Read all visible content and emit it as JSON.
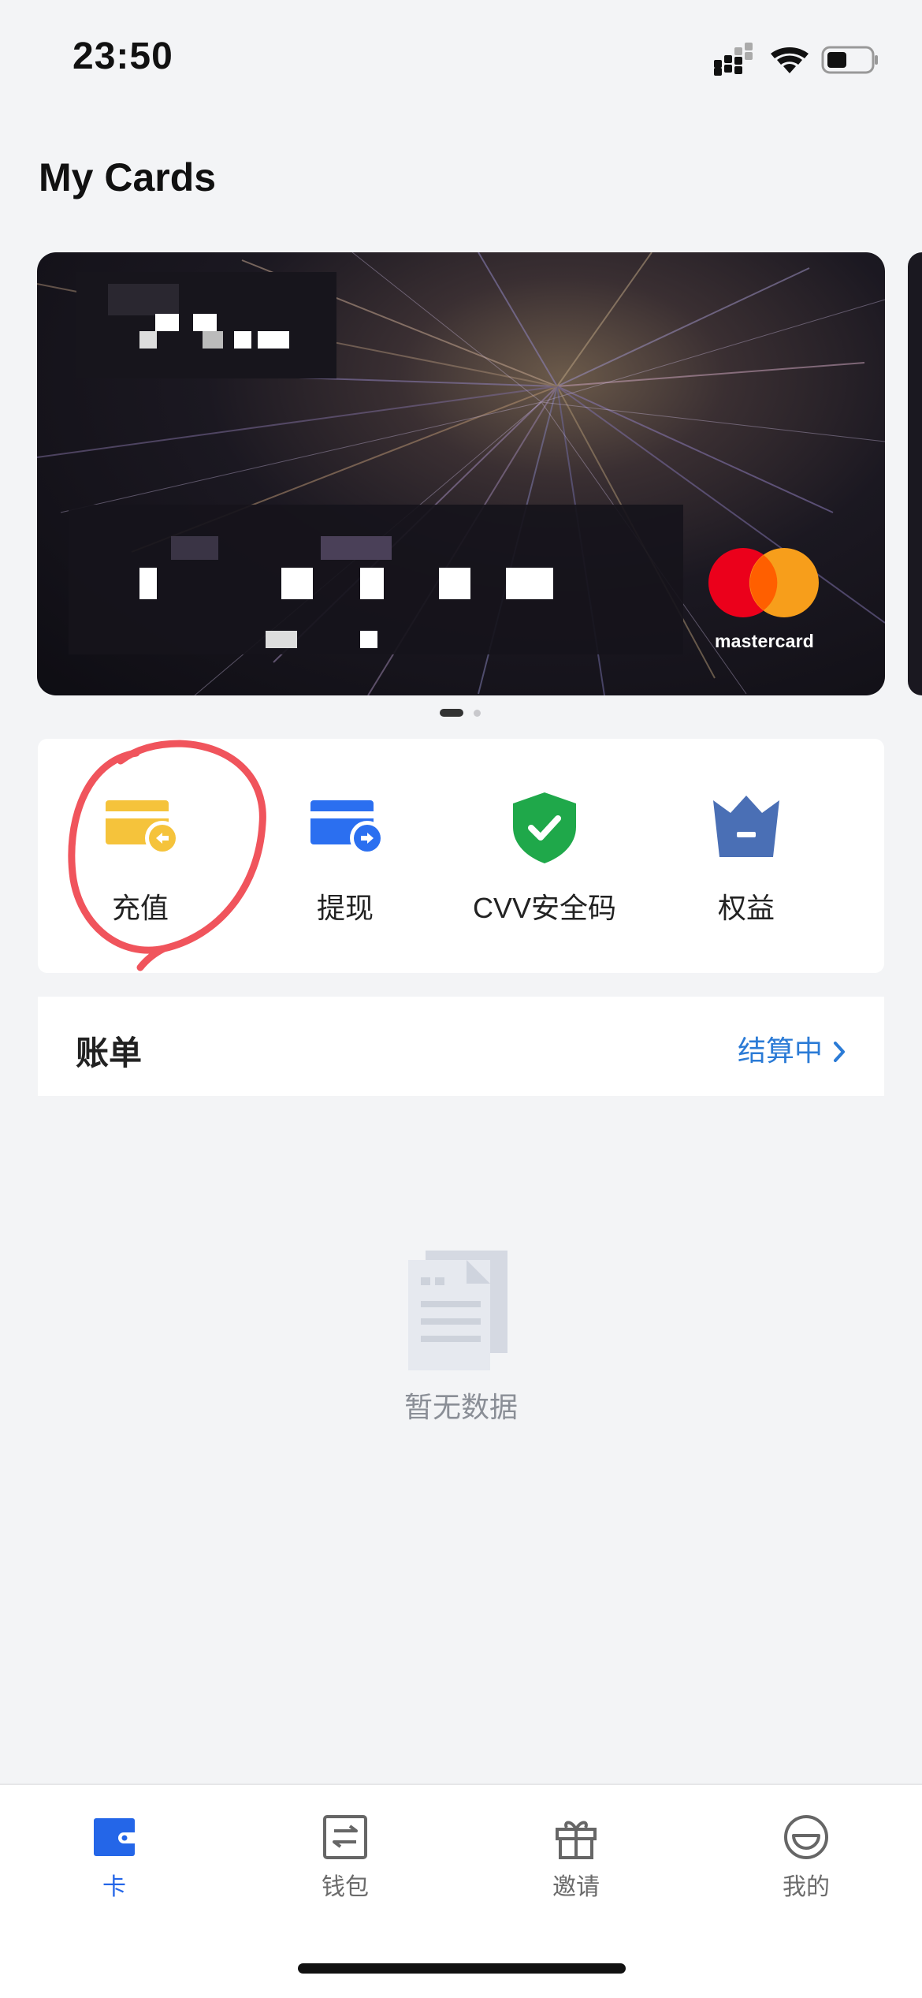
{
  "status_bar": {
    "time": "23:50"
  },
  "page": {
    "title": "My Cards"
  },
  "card": {
    "brand_label": "mastercard"
  },
  "actions": [
    {
      "label": "充值",
      "icon": "card-top-up-icon",
      "color": "#f5c33b"
    },
    {
      "label": "提现",
      "icon": "card-withdraw-icon",
      "color": "#2b6ff0"
    },
    {
      "label": "CVV安全码",
      "icon": "shield-check-icon",
      "color": "#1fa84a"
    },
    {
      "label": "权益",
      "icon": "crown-icon",
      "color": "#4a6fb5"
    }
  ],
  "bill": {
    "title": "账单",
    "status": "结算中"
  },
  "empty_state": {
    "text": "暂无数据"
  },
  "tabs": [
    {
      "label": "卡",
      "icon": "card-icon",
      "active": true
    },
    {
      "label": "钱包",
      "icon": "wallet-icon",
      "active": false
    },
    {
      "label": "邀请",
      "icon": "gift-icon",
      "active": false
    },
    {
      "label": "我的",
      "icon": "profile-icon",
      "active": false
    }
  ],
  "colors": {
    "accent": "#2466e8",
    "annotation": "#f0545c",
    "link": "#2b7bd6"
  }
}
